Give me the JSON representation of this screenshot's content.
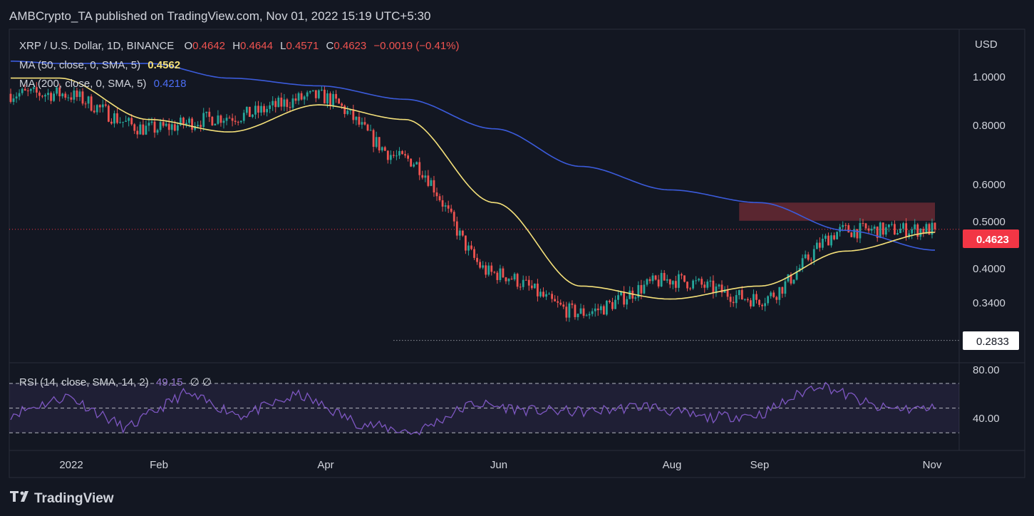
{
  "header": {
    "publisher": "AMBCrypto_TA published on TradingView.com, Nov 01, 2022 15:19 UTC+5:30"
  },
  "legend": {
    "symbol": "XRP / U.S. Dollar, 1D, BINANCE",
    "o_label": "O",
    "o": "0.4642",
    "h_label": "H",
    "h": "0.4644",
    "l_label": "L",
    "l": "0.4571",
    "c_label": "C",
    "c": "0.4623",
    "change": "−0.0019 (−0.41%)",
    "ma50_label": "MA (50, close, 0, SMA, 5)",
    "ma50": "0.4562",
    "ma200_label": "MA (200, close, 0, SMA, 5)",
    "ma200": "0.4218",
    "rsi_label": "RSI (14, close, SMA, 14, 2)",
    "rsi": "49.15",
    "rsi_extra": "∅ ∅"
  },
  "price_axis": {
    "currency": "USD",
    "ticks": [
      "1.0000",
      "0.8000",
      "0.6000",
      "0.5000",
      "0.4000",
      "0.3400"
    ],
    "last_price_tag": "0.4623",
    "support_tag": "0.2833"
  },
  "rsi_axis": {
    "ticks": [
      "80.00",
      "40.00"
    ]
  },
  "time_axis": {
    "ticks": [
      "2022",
      "Feb",
      "Apr",
      "Jun",
      "Aug",
      "Sep",
      "Nov"
    ]
  },
  "footer": {
    "brand": "TradingView"
  },
  "colors": {
    "background": "#131722",
    "up": "#26a69a",
    "down": "#ef5350",
    "ma50": "#f5e17a",
    "ma200": "#3b5bdb",
    "rsi": "#7e57c2",
    "resistance_zone": "#6d2a35",
    "last_price": "#f23645"
  },
  "chart_data": {
    "type": "candlestick",
    "title": "XRP / U.S. Dollar, 1D, BINANCE",
    "scale": "log",
    "ylim": [
      0.26,
      1.12
    ],
    "x": [
      "2021-12-15",
      "2022-01-01",
      "2022-02-01",
      "2022-03-01",
      "2022-04-01",
      "2022-05-01",
      "2022-06-01",
      "2022-07-01",
      "2022-08-01",
      "2022-09-01",
      "2022-10-01",
      "2022-11-01"
    ],
    "close": [
      0.84,
      0.84,
      0.72,
      0.76,
      0.83,
      0.63,
      0.38,
      0.32,
      0.37,
      0.34,
      0.46,
      0.4623
    ],
    "ma50": [
      null,
      0.9,
      0.75,
      0.71,
      0.8,
      0.75,
      0.52,
      0.36,
      0.34,
      0.36,
      0.42,
      0.4562
    ],
    "ma200": [
      0.97,
      0.96,
      0.96,
      0.9,
      0.87,
      0.82,
      0.72,
      0.61,
      0.55,
      0.52,
      0.46,
      0.4218
    ],
    "resistance_zone": [
      0.48,
      0.52
    ],
    "support_line": 0.2833,
    "rsi": {
      "values": [
        45,
        60,
        33,
        62,
        44,
        61,
        38,
        30,
        54,
        48,
        47,
        52,
        42,
        45,
        70,
        50,
        49.15
      ],
      "levels": [
        70,
        50,
        30
      ],
      "ylim": [
        18,
        85
      ]
    }
  }
}
